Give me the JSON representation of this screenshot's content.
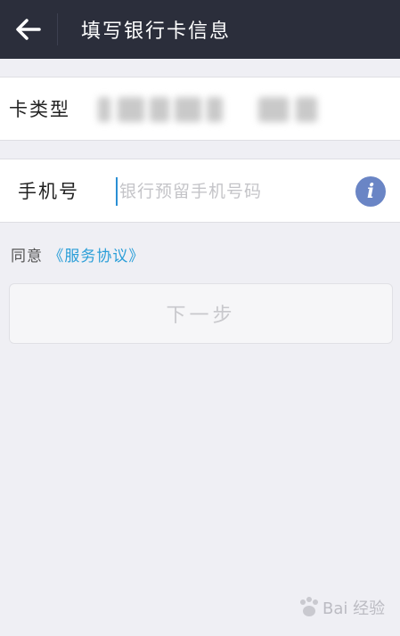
{
  "header": {
    "title": "填写银行卡信息",
    "back_icon": "arrow-left-icon"
  },
  "card_row": {
    "label": "卡类型"
  },
  "phone_row": {
    "label": "手机号",
    "value": "",
    "placeholder": "银行预留手机号码",
    "info_icon": "info-icon",
    "info_glyph": "i"
  },
  "agreement": {
    "prefix": "同意",
    "link": "《服务协议》"
  },
  "next_button": {
    "label": "下一步"
  },
  "watermark": {
    "text": "Bai 经验"
  },
  "colors": {
    "header_bg": "#2b2e3b",
    "link": "#2a9ed8",
    "info": "#6a85c5",
    "background": "#efeff4"
  }
}
